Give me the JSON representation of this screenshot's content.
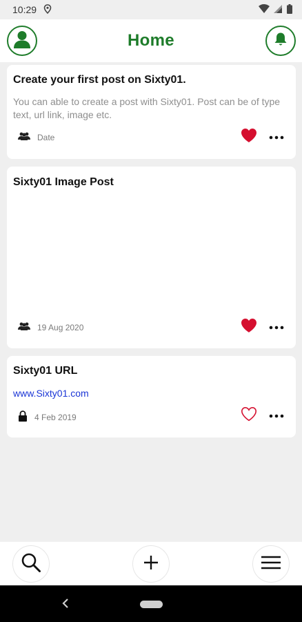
{
  "status_bar": {
    "time": "10:29",
    "icons": [
      "location-icon",
      "wifi-icon",
      "signal-icon",
      "battery-icon"
    ]
  },
  "header": {
    "title": "Home",
    "left_icon": "profile-icon",
    "right_icon": "bell-icon"
  },
  "posts": [
    {
      "title": "Create your first post on Sixty01.",
      "description": "You can able to create a post with Sixty01. Post can be of type text, url link, image etc.",
      "meta_icon": "group-icon",
      "date": "Date",
      "liked": true
    },
    {
      "title": "Sixty01 Image Post",
      "meta_icon": "group-icon",
      "date": "19 Aug 2020",
      "liked": true
    },
    {
      "title": "Sixty01 URL",
      "link": "www.Sixty01.com",
      "meta_icon": "lock-icon",
      "date": "4 Feb 2019",
      "liked": false
    }
  ],
  "bottom_nav": {
    "items": [
      "search-icon",
      "plus-icon",
      "menu-icon"
    ]
  },
  "colors": {
    "accent": "#1e7c2a",
    "heart": "#d50f2f",
    "link": "#1a35d6",
    "background": "#efefef"
  }
}
